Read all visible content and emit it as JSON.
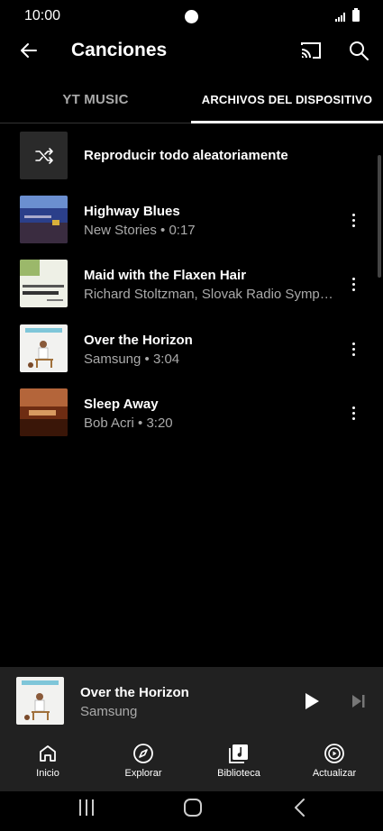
{
  "status_bar": {
    "time": "10:00"
  },
  "app_bar": {
    "title": "Canciones"
  },
  "tabs": [
    {
      "label": "YT MUSIC",
      "selected": false
    },
    {
      "label": "ARCHIVOS DEL DISPOSITIVO",
      "selected": true
    }
  ],
  "shuffle": {
    "label": "Reproducir todo aleatoriamente"
  },
  "songs": [
    {
      "title": "Highway Blues",
      "subtitle": "New Stories • 0:17"
    },
    {
      "title": "Maid with the Flaxen Hair",
      "subtitle": "Richard Stoltzman, Slovak Radio Symp…"
    },
    {
      "title": "Over the Horizon",
      "subtitle": "Samsung • 3:04"
    },
    {
      "title": "Sleep Away",
      "subtitle": "Bob Acri • 3:20"
    }
  ],
  "now_playing": {
    "title": "Over the Horizon",
    "artist": "Samsung"
  },
  "bottom_nav": [
    {
      "label": "Inicio",
      "icon": "home-icon"
    },
    {
      "label": "Explorar",
      "icon": "compass-icon"
    },
    {
      "label": "Biblioteca",
      "icon": "library-icon"
    },
    {
      "label": "Actualizar",
      "icon": "upgrade-icon"
    }
  ],
  "colors": {
    "background": "#000000",
    "panel": "#212121",
    "secondary_text": "#aaaaaa"
  }
}
